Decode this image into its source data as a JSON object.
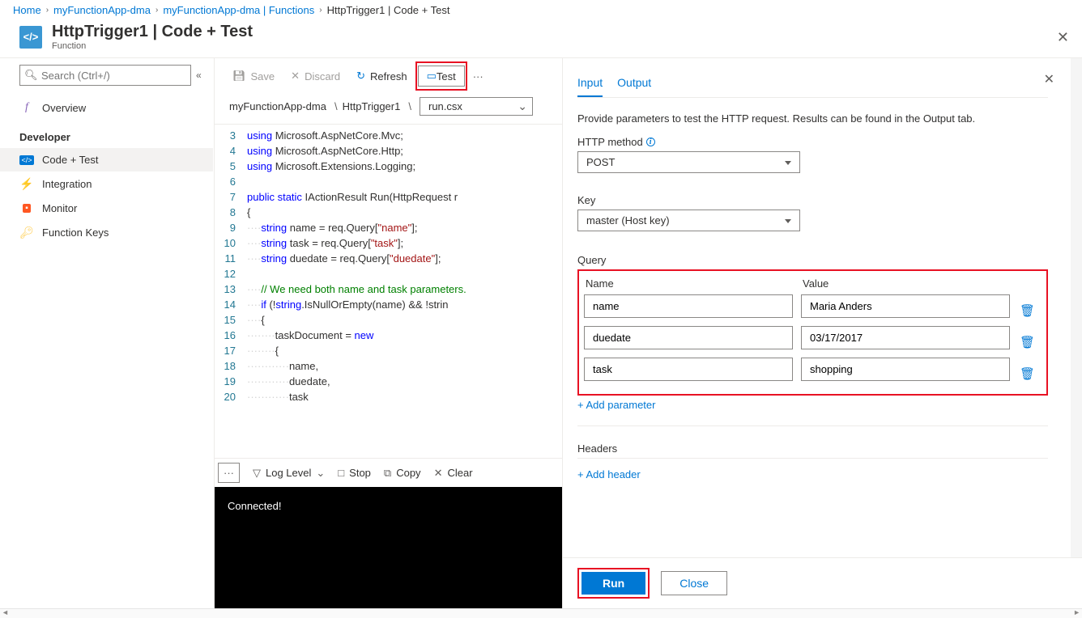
{
  "breadcrumb": {
    "items": [
      "Home",
      "myFunctionApp-dma",
      "myFunctionApp-dma | Functions",
      "HttpTrigger1 | Code + Test"
    ]
  },
  "header": {
    "icon": "</>",
    "title": "HttpTrigger1 | Code + Test",
    "subtitle": "Function"
  },
  "search": {
    "placeholder": "Search (Ctrl+/)"
  },
  "sidebar": {
    "overview": "Overview",
    "devHeading": "Developer",
    "items": [
      {
        "label": "Code + Test"
      },
      {
        "label": "Integration"
      },
      {
        "label": "Monitor"
      },
      {
        "label": "Function Keys"
      }
    ]
  },
  "toolbar": {
    "save": "Save",
    "discard": "Discard",
    "refresh": "Refresh",
    "test": "Test",
    "more": "···"
  },
  "pathbar": {
    "app": "myFunctionApp-dma",
    "func": "HttpTrigger1",
    "file": "run.csx"
  },
  "code": {
    "lines": [
      {
        "n": 3,
        "html": "<span class='kw'>using</span> Microsoft.AspNetCore.Mvc;"
      },
      {
        "n": 4,
        "html": "<span class='kw'>using</span> Microsoft.AspNetCore.Http;"
      },
      {
        "n": 5,
        "html": "<span class='kw'>using</span> Microsoft.Extensions.Logging;"
      },
      {
        "n": 6,
        "html": ""
      },
      {
        "n": 7,
        "html": "<span class='kw'>public</span> <span class='kw'>static</span> IActionResult Run(HttpRequest r"
      },
      {
        "n": 8,
        "html": "{"
      },
      {
        "n": 9,
        "html": "<span class='ws'>····</span><span class='kw'>string</span> name = req.Query[<span class='str'>\"name\"</span>];"
      },
      {
        "n": 10,
        "html": "<span class='ws'>····</span><span class='kw'>string</span> task = req.Query[<span class='str'>\"task\"</span>];"
      },
      {
        "n": 11,
        "html": "<span class='ws'>····</span><span class='kw'>string</span> duedate = req.Query[<span class='str'>\"duedate\"</span>];"
      },
      {
        "n": 12,
        "html": ""
      },
      {
        "n": 13,
        "html": "<span class='ws'>····</span><span class='comment'>// We need both name and task parameters.</span>"
      },
      {
        "n": 14,
        "html": "<span class='ws'>····</span><span class='kw'>if</span> (!<span class='kw'>string</span>.IsNullOrEmpty(name) && !strin"
      },
      {
        "n": 15,
        "html": "<span class='ws'>····</span>{"
      },
      {
        "n": 16,
        "html": "<span class='ws'>········</span>taskDocument = <span class='kw'>new</span>"
      },
      {
        "n": 17,
        "html": "<span class='ws'>········</span>{"
      },
      {
        "n": 18,
        "html": "<span class='ws'>············</span>name,"
      },
      {
        "n": 19,
        "html": "<span class='ws'>············</span>duedate,"
      },
      {
        "n": 20,
        "html": "<span class='ws'>············</span>task"
      }
    ]
  },
  "logToolbar": {
    "more": "···",
    "logLevel": "Log Level",
    "stop": "Stop",
    "copy": "Copy",
    "clear": "Clear"
  },
  "console": {
    "status": "Connected!"
  },
  "panel": {
    "tabs": {
      "input": "Input",
      "output": "Output"
    },
    "desc": "Provide parameters to test the HTTP request. Results can be found in the Output tab.",
    "httpMethod": {
      "label": "HTTP method",
      "value": "POST"
    },
    "key": {
      "label": "Key",
      "value": "master (Host key)"
    },
    "query": {
      "label": "Query",
      "nameHeader": "Name",
      "valueHeader": "Value",
      "rows": [
        {
          "name": "name",
          "value": "Maria Anders"
        },
        {
          "name": "duedate",
          "value": "03/17/2017"
        },
        {
          "name": "task",
          "value": "shopping"
        }
      ],
      "addLink": "+ Add parameter"
    },
    "headers": {
      "label": "Headers",
      "addLink": "+ Add header"
    },
    "footer": {
      "run": "Run",
      "close": "Close"
    }
  }
}
